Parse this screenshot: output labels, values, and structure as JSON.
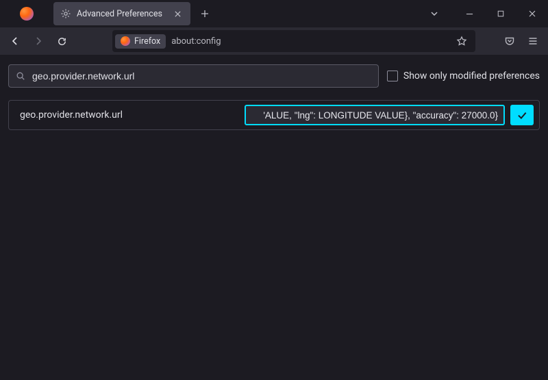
{
  "window": {
    "tab_title": "Advanced Preferences"
  },
  "toolbar": {
    "identity_label": "Firefox",
    "url": "about:config"
  },
  "search": {
    "value": "geo.provider.network.url",
    "show_modified_label": "Show only modified preferences"
  },
  "pref": {
    "name": "geo.provider.network.url",
    "value": "'ALUE, \"lng\": LONGITUDE VALUE}, \"accuracy\": 27000.0}"
  }
}
